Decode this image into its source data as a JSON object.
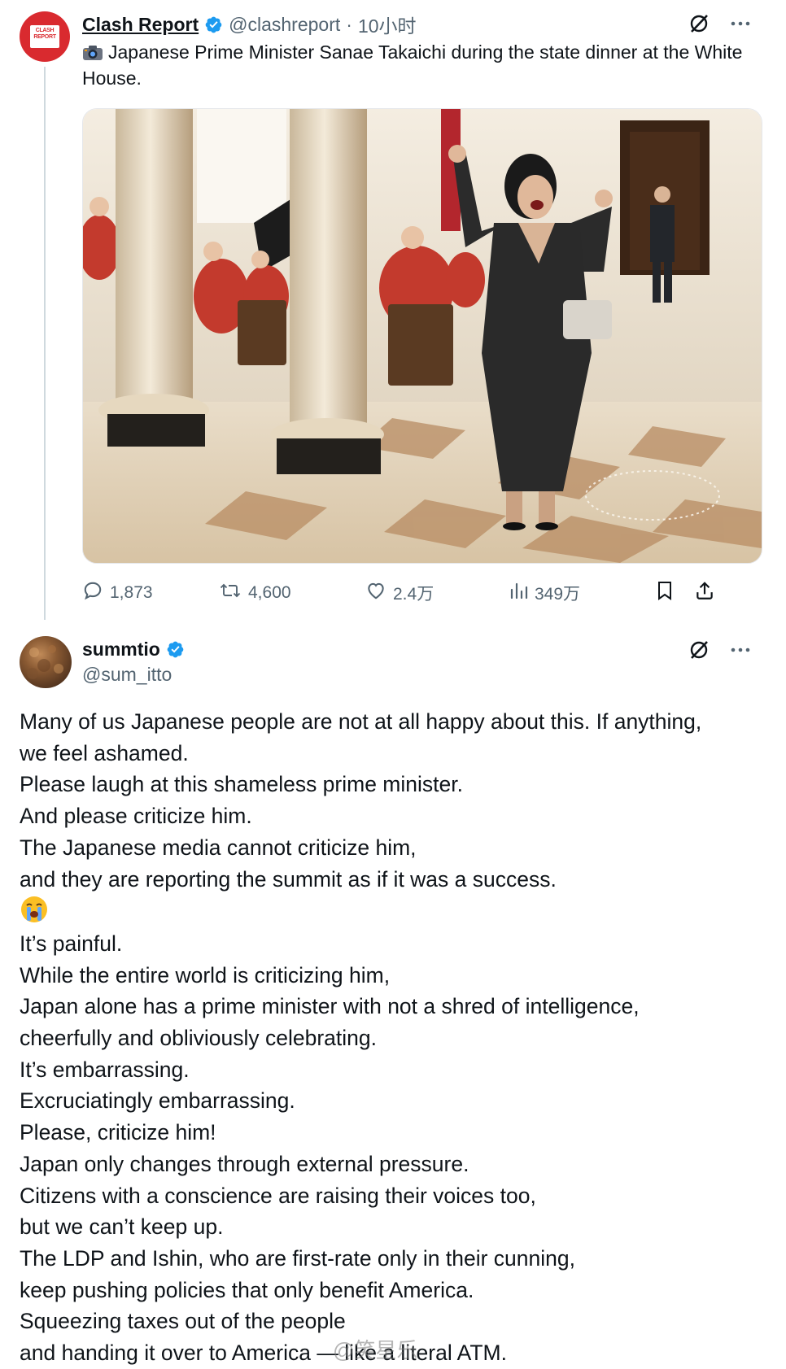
{
  "post1": {
    "avatar_text": "CLASH REPORT",
    "name": "Clash Report",
    "handle": "@clashreport",
    "separator": "·",
    "time": "10小时",
    "camera_icon": "camera-icon",
    "text": "Japanese Prime Minister Sanae Takaichi during the state dinner at the White House.",
    "image_icon": "photo",
    "stats": {
      "replies": "1,873",
      "reposts": "4,600",
      "likes": "2.4万",
      "views": "349万"
    }
  },
  "post2": {
    "name": "summtio",
    "handle": "@sum_itto",
    "lines": [
      "Many of us Japanese people are not at all happy about this. If anything,",
      "we feel ashamed.",
      "Please laugh at this shameless prime minister.",
      "And please criticize him.",
      "The Japanese media cannot criticize him,",
      "and they are reporting the summit as if it was a success.",
      "",
      "It’s painful.",
      "While the entire world is criticizing him,",
      "Japan alone has a prime minister with not a shred of intelligence,",
      "cheerfully and obliviously celebrating.",
      "It’s embarrassing.",
      "Excruciatingly embarrassing.",
      "Please, criticize him!",
      "Japan only changes through external pressure.",
      "Citizens with a conscience are raising their voices too,",
      "but we can’t keep up.",
      "The LDP and Ishin, who are first-rate only in their cunning,",
      "keep pushing policies that only benefit America.",
      "Squeezing taxes out of the people",
      "and handing it over to America — like a literal ATM."
    ],
    "emoji_line_icon": "loudly-crying-face-icon"
  },
  "watermark": "@笑星乐",
  "colors": {
    "verified": "#1d9bf0",
    "text": "#0f1419",
    "muted": "#536471",
    "clash_red": "#d92a2f"
  }
}
